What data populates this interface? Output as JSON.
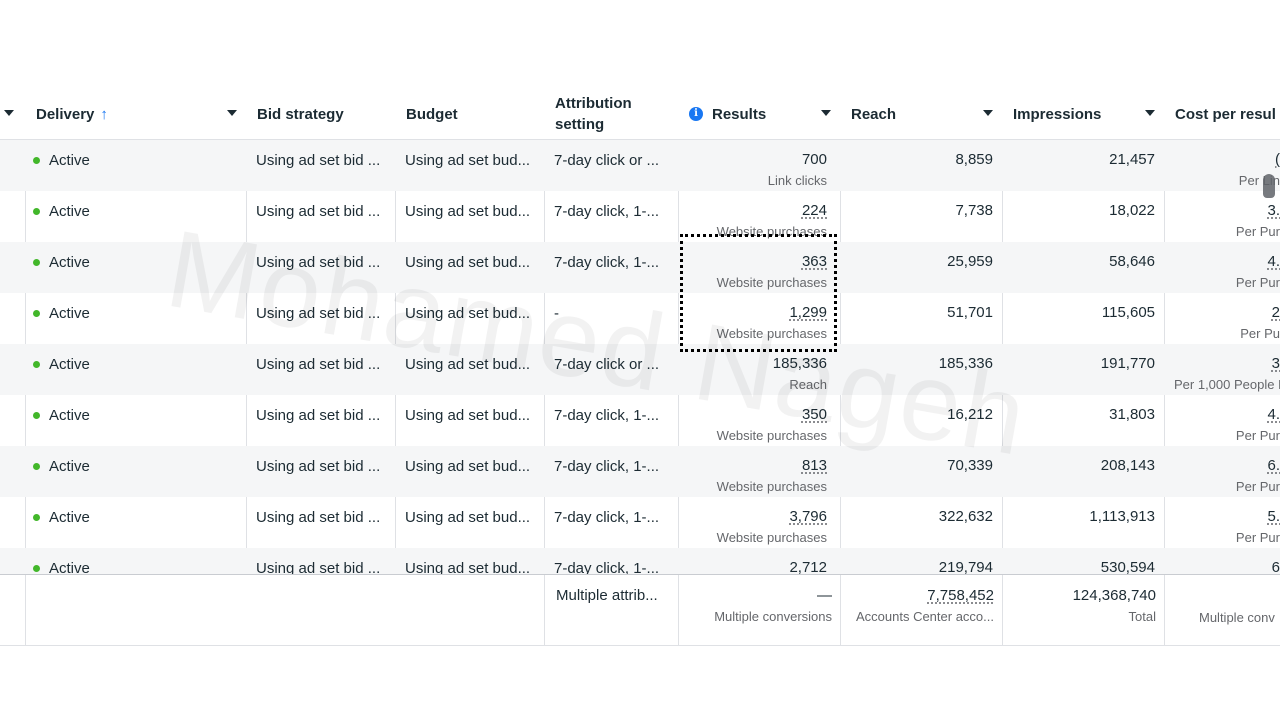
{
  "columns": {
    "delivery": "Delivery",
    "bid_strategy": "Bid strategy",
    "budget": "Budget",
    "attribution": "Attribution setting",
    "results": "Results",
    "reach": "Reach",
    "impressions": "Impressions",
    "cost_per_result": "Cost per resul"
  },
  "sort_indicator": "↑",
  "info_icon": "i",
  "accent_color": "#1877f2",
  "status_color": "#42b72a",
  "rows": [
    {
      "delivery": "Active",
      "bid": "Using ad set bid ...",
      "budget": "Using ad set bud...",
      "attribution": "7-day click or ...",
      "results": "700",
      "results_label": "Link clicks",
      "reach": "8,859",
      "impressions": "21,457",
      "cost": "(",
      "cost_label": "Per Lin"
    },
    {
      "delivery": "Active",
      "bid": "Using ad set bid ...",
      "budget": "Using ad set bud...",
      "attribution": "7-day click, 1-...",
      "results": "224",
      "results_label": "Website purchases",
      "reach": "7,738",
      "impressions": "18,022",
      "cost": "3.",
      "cost_label": "Per Pur"
    },
    {
      "delivery": "Active",
      "bid": "Using ad set bid ...",
      "budget": "Using ad set bud...",
      "attribution": "7-day click, 1-...",
      "results": "363",
      "results_label": "Website purchases",
      "reach": "25,959",
      "impressions": "58,646",
      "cost": "4.",
      "cost_label": "Per Pur"
    },
    {
      "delivery": "Active",
      "bid": "Using ad set bid ...",
      "budget": "Using ad set bud...",
      "attribution": "-",
      "results": "1,299",
      "results_label": "Website purchases",
      "reach": "51,701",
      "impressions": "115,605",
      "cost": "2",
      "cost_label": "Per Pu"
    },
    {
      "delivery": "Active",
      "bid": "Using ad set bid ...",
      "budget": "Using ad set bud...",
      "attribution": "7-day click or ...",
      "results": "185,336",
      "results_label": "Reach",
      "reach": "185,336",
      "impressions": "191,770",
      "cost": "3",
      "cost_label": "Per 1,000 People R"
    },
    {
      "delivery": "Active",
      "bid": "Using ad set bid ...",
      "budget": "Using ad set bud...",
      "attribution": "7-day click, 1-...",
      "results": "350",
      "results_label": "Website purchases",
      "reach": "16,212",
      "impressions": "31,803",
      "cost": "4.",
      "cost_label": "Per Pur"
    },
    {
      "delivery": "Active",
      "bid": "Using ad set bid ...",
      "budget": "Using ad set bud...",
      "attribution": "7-day click, 1-...",
      "results": "813",
      "results_label": "Website purchases",
      "reach": "70,339",
      "impressions": "208,143",
      "cost": "6.",
      "cost_label": "Per Pur"
    },
    {
      "delivery": "Active",
      "bid": "Using ad set bid ...",
      "budget": "Using ad set bud...",
      "attribution": "7-day click, 1-...",
      "results": "3,796",
      "results_label": "Website purchases",
      "reach": "322,632",
      "impressions": "1,113,913",
      "cost": "5.",
      "cost_label": "Per Pur"
    },
    {
      "delivery": "Active",
      "bid": "Using ad set bid ...",
      "budget": "Using ad set bud...",
      "attribution": "7-day click, 1-...",
      "results": "2,712",
      "results_label": "",
      "reach": "219,794",
      "impressions": "530,594",
      "cost": "6",
      "cost_label": ""
    }
  ],
  "totals": {
    "attribution": "Multiple attrib...",
    "results": "—",
    "results_label": "Multiple conversions",
    "reach": "7,758,452",
    "reach_label": "Accounts Center acco...",
    "impressions": "124,368,740",
    "impressions_label": "Total",
    "cost_label": "Multiple conv"
  },
  "watermark": "Mohamed Nageh"
}
